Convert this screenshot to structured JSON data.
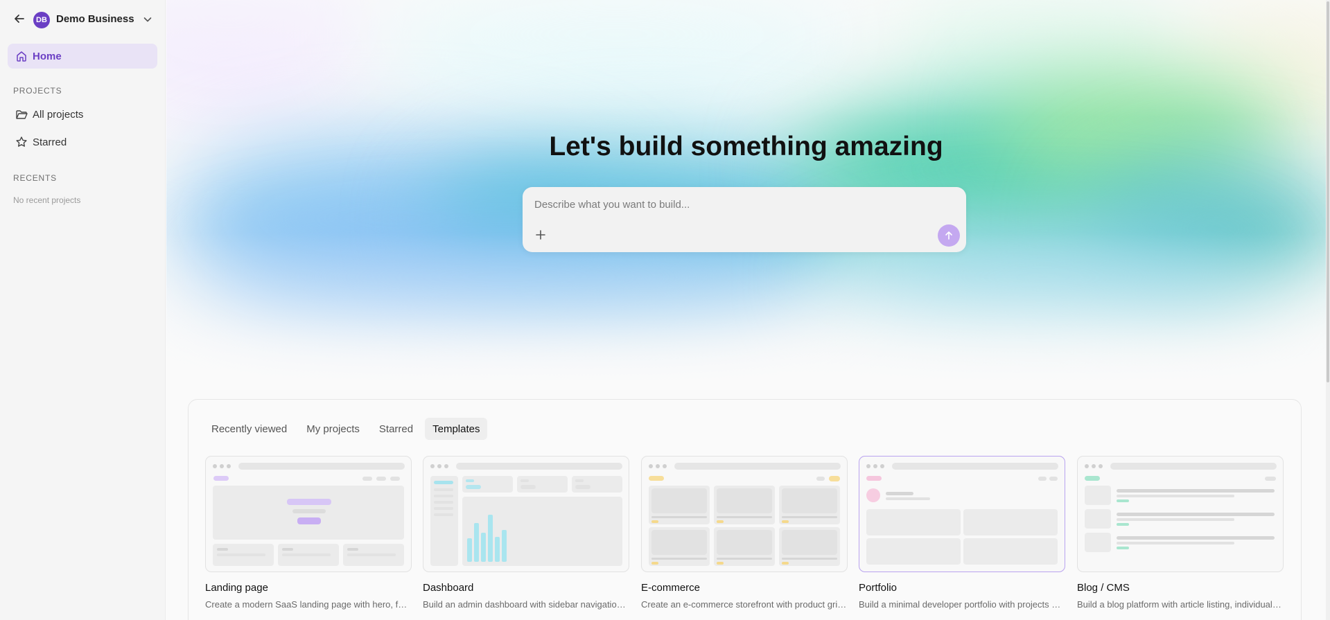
{
  "sidebar": {
    "workspace": {
      "initials": "DB",
      "name": "Demo Business"
    },
    "home_label": "Home",
    "projects_section": "PROJECTS",
    "projects_items": [
      {
        "label": "All projects",
        "icon": "folder-icon"
      },
      {
        "label": "Starred",
        "icon": "star-icon"
      }
    ],
    "recents_section": "RECENTS",
    "recents_empty": "No recent projects"
  },
  "hero": {
    "headline": "Let's build something amazing",
    "prompt_placeholder": "Describe what you want to build..."
  },
  "tabs": [
    {
      "label": "Recently viewed",
      "active": false
    },
    {
      "label": "My projects",
      "active": false
    },
    {
      "label": "Starred",
      "active": false
    },
    {
      "label": "Templates",
      "active": true
    }
  ],
  "templates": [
    {
      "title": "Landing page",
      "description": "Create a modern SaaS landing page with hero, features, pricing and footer"
    },
    {
      "title": "Dashboard",
      "description": "Build an admin dashboard with sidebar navigation, charts and tables"
    },
    {
      "title": "E-commerce",
      "description": "Create an e-commerce storefront with product grid and cart"
    },
    {
      "title": "Portfolio",
      "description": "Build a minimal developer portfolio with projects and contact section"
    },
    {
      "title": "Blog / CMS",
      "description": "Build a blog platform with article listing, individual posts and editor"
    }
  ],
  "colors": {
    "accent": "#6b3fc4",
    "accent_soft": "#e9e3f6",
    "send_button": "#c4a8f0"
  }
}
